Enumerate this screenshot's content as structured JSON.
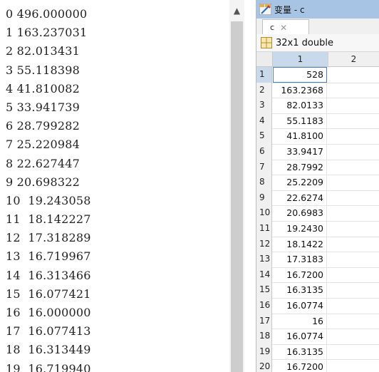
{
  "console": {
    "lines": [
      "0 496.000000",
      "1 163.237031",
      "2 82.013431",
      "3 55.118398",
      "4 41.810082",
      "5 33.941739",
      "6 28.799282",
      "7 25.220984",
      "8 22.627447",
      "9 20.698322",
      "10  19.243058",
      "11  18.142227",
      "12  17.318289",
      "13  16.719967",
      "14  16.313466",
      "15  16.077421",
      "16  16.000000",
      "17  16.077413",
      "18  16.313449",
      "19  16.719940"
    ]
  },
  "scrollbar": {
    "up_icon": "▲"
  },
  "variable_editor": {
    "title": "变量 - c",
    "tab_label": "c",
    "tab_close": "✕",
    "info": "32x1 double",
    "columns": [
      "1",
      "2"
    ],
    "rows": [
      {
        "index": "1",
        "value": "528"
      },
      {
        "index": "2",
        "value": "163.2368"
      },
      {
        "index": "3",
        "value": "82.0133"
      },
      {
        "index": "4",
        "value": "55.1183"
      },
      {
        "index": "5",
        "value": "41.8100"
      },
      {
        "index": "6",
        "value": "33.9417"
      },
      {
        "index": "7",
        "value": "28.7992"
      },
      {
        "index": "8",
        "value": "25.2209"
      },
      {
        "index": "9",
        "value": "22.6274"
      },
      {
        "index": "10",
        "value": "20.6983"
      },
      {
        "index": "11",
        "value": "19.2430"
      },
      {
        "index": "12",
        "value": "18.1422"
      },
      {
        "index": "13",
        "value": "17.3183"
      },
      {
        "index": "14",
        "value": "16.7200"
      },
      {
        "index": "15",
        "value": "16.3135"
      },
      {
        "index": "16",
        "value": "16.0774"
      },
      {
        "index": "17",
        "value": "16"
      },
      {
        "index": "18",
        "value": "16.0774"
      },
      {
        "index": "19",
        "value": "16.3135"
      },
      {
        "index": "20",
        "value": "16.7200"
      }
    ]
  },
  "colors": {
    "titlebar": "#a8c4e4",
    "selection": "#c9d9ec",
    "active_cell_border": "#4a7ec1"
  }
}
